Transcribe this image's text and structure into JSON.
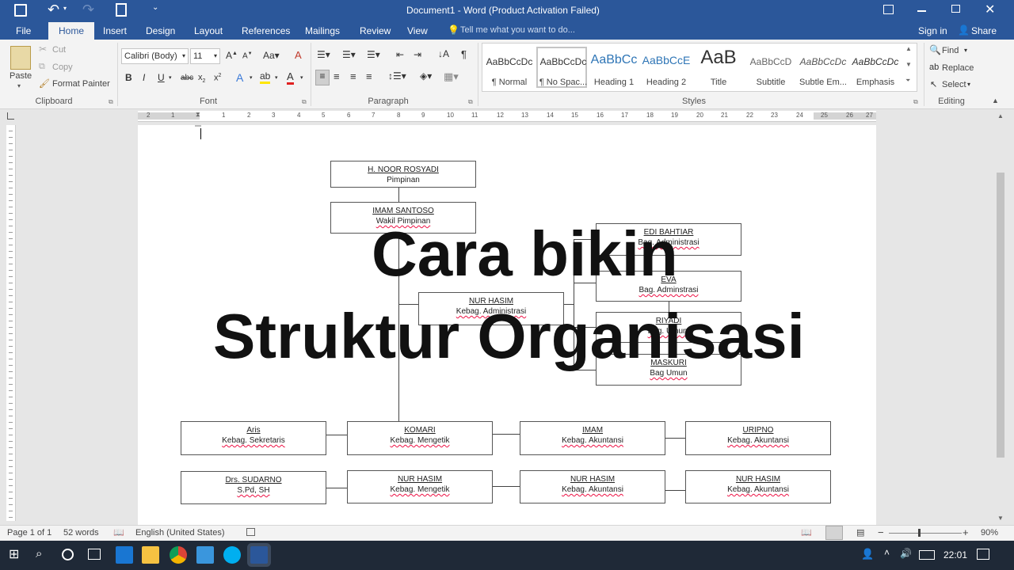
{
  "window": {
    "title": "Document1 - Word (Product Activation Failed)",
    "controls": [
      "restore-ribbon",
      "minimize",
      "maximize",
      "close"
    ]
  },
  "quick_access": {
    "save": "save",
    "undo": "undo",
    "redo": "redo",
    "print_preview": "print-preview",
    "customize": "customize"
  },
  "tabs": [
    "File",
    "Home",
    "Insert",
    "Design",
    "Layout",
    "References",
    "Mailings",
    "Review",
    "View"
  ],
  "tell_me": "Tell me what you want to do...",
  "sign_in": "Sign in",
  "share": "Share",
  "ribbon": {
    "clipboard": {
      "paste": "Paste",
      "cut": "Cut",
      "copy": "Copy",
      "format_painter": "Format Painter",
      "label": "Clipboard"
    },
    "font": {
      "name": "Calibri (Body)",
      "size": "11",
      "label": "Font"
    },
    "paragraph": {
      "label": "Paragraph"
    },
    "styles": {
      "label": "Styles",
      "items": [
        {
          "preview": "AaBbCcDc",
          "label": "¶ Normal"
        },
        {
          "preview": "AaBbCcDc",
          "label": "¶ No Spac..."
        },
        {
          "preview": "AaBbCc",
          "label": "Heading 1"
        },
        {
          "preview": "AaBbCcE",
          "label": "Heading 2"
        },
        {
          "preview": "AaB",
          "label": "Title"
        },
        {
          "preview": "AaBbCcD",
          "label": "Subtitle"
        },
        {
          "preview": "AaBbCcDc",
          "label": "Subtle Em..."
        },
        {
          "preview": "AaBbCcDc",
          "label": "Emphasis"
        }
      ]
    },
    "editing": {
      "find": "Find",
      "replace": "Replace",
      "select": "Select",
      "label": "Editing"
    }
  },
  "ruler_numbers": [
    "2",
    "1",
    "1",
    "2",
    "3",
    "4",
    "5",
    "6",
    "7",
    "8",
    "9",
    "10",
    "11",
    "12",
    "13",
    "14",
    "15",
    "16",
    "17",
    "18",
    "19",
    "20",
    "21",
    "22",
    "23",
    "24",
    "25",
    "26",
    "27"
  ],
  "org": {
    "top": {
      "name": "H. NOOR ROSYADI",
      "role": "Pimpinan"
    },
    "deputy": {
      "name": "IMAM SANTOSO",
      "role": "Wakil Pimpinan"
    },
    "center": {
      "name": "NUR HASIM",
      "role": "Kebag. Administrasi"
    },
    "right": [
      {
        "name": "EDI BAHTIAR",
        "role": "Bag. Administrasi"
      },
      {
        "name": "EVA",
        "role": "Bag. Adminstrasi"
      },
      {
        "name": "RIYADI",
        "role": "Bag. Umum"
      },
      {
        "name": "MASKURI",
        "role": "Bag Umun"
      }
    ],
    "row1": [
      {
        "name": "Aris",
        "role": "Kebag. Sekretaris"
      },
      {
        "name": "KOMARI",
        "role": "Kebag. Mengetik"
      },
      {
        "name": "IMAM",
        "role": "Kebag. Akuntansi"
      },
      {
        "name": "URIPNO",
        "role": "Kebag. Akuntansi"
      }
    ],
    "row2": [
      {
        "name": "Drs. SUDARNO",
        "role": "S.Pd, SH"
      },
      {
        "name": "NUR HASIM",
        "role": "Kebag. Mengetik"
      },
      {
        "name": "NUR HASIM",
        "role": "Kebag. Akuntansi"
      },
      {
        "name": "NUR HASIM",
        "role": "Kebag. Akuntansi"
      }
    ]
  },
  "overlay": {
    "line1": "Cara bikin",
    "line2": "Struktur Organisasi"
  },
  "status": {
    "page": "Page 1 of 1",
    "words": "52 words",
    "language": "English (United States)",
    "zoom": "90%"
  },
  "taskbar": {
    "time": "22:01"
  },
  "colors": {
    "word_blue": "#2b579a",
    "taskbar": "#1f2937"
  }
}
